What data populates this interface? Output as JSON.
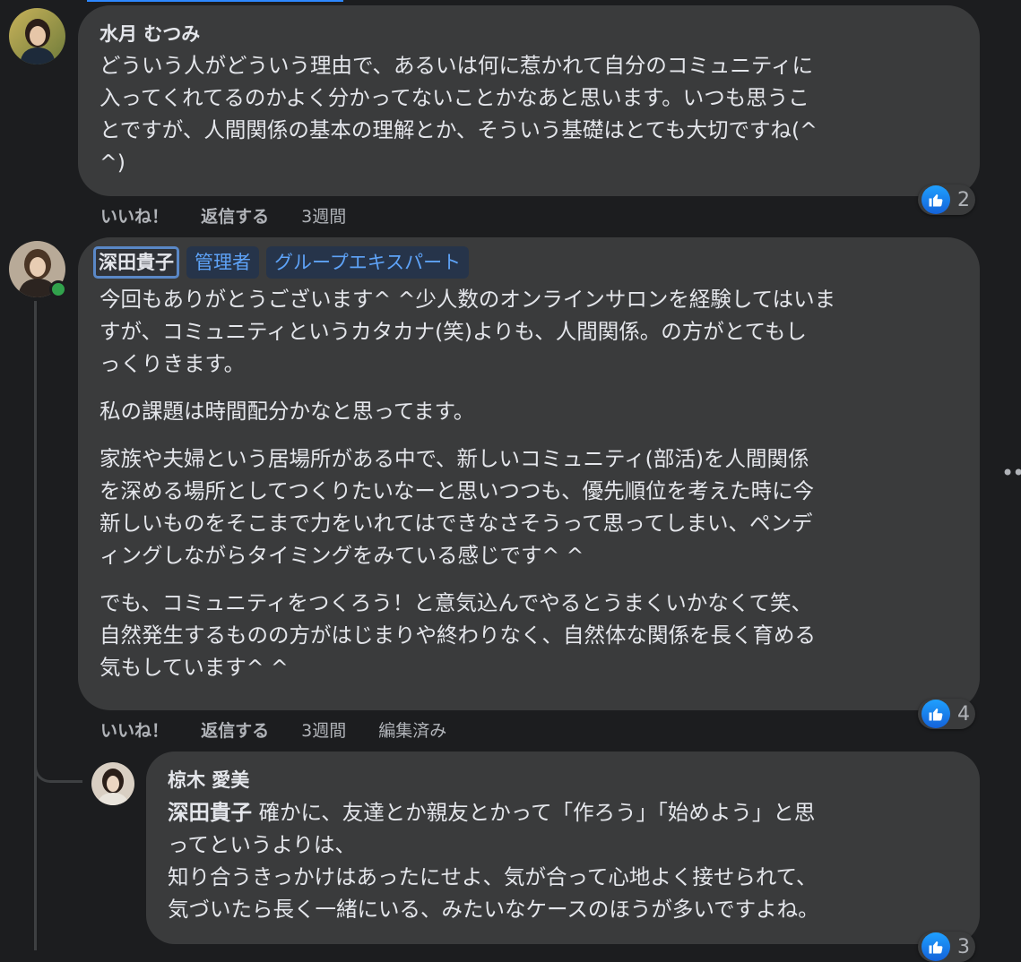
{
  "comments": [
    {
      "author": "水月 むつみ",
      "lines": [
        "どういう人がどういう理由で、あるいは何に惹かれて自分のコミュニティに",
        "入ってくれてるのかよく分かってないことかなあと思います。いつも思うこ",
        "とですが、人間関係の基本の理解とか、そういう基礎はとても大切ですね(^",
        "^)"
      ],
      "actions": {
        "like": "いいね！",
        "reply": "返信する",
        "time": "3週間"
      },
      "reactions": {
        "icon": "like-icon",
        "count": "2"
      }
    },
    {
      "author": "深田貴子",
      "badges": [
        "管理者",
        "グループエキスパート"
      ],
      "paragraphs": [
        [
          "今回もありがとうございます^ ^少人数のオンラインサロンを経験してはいま",
          "すが、コミュニティというカタカナ(笑)よりも、人間関係。の方がとてもし",
          "っくりきます。"
        ],
        [
          "私の課題は時間配分かなと思ってます。"
        ],
        [
          "家族や夫婦という居場所がある中で、新しいコミュニティ(部活)を人間関係",
          "を深める場所としてつくりたいなーと思いつつも、優先順位を考えた時に今",
          "新しいものをそこまで力をいれてはできなさそうって思ってしまい、ペンデ",
          "ィングしながらタイミングをみている感じです^ ^"
        ],
        [
          "でも、コミュニティをつくろう！と意気込んでやるとうまくいかなくて笑、",
          "自然発生するものの方がはじまりや終わりなく、自然体な関係を長く育める",
          "気もしています^ ^"
        ]
      ],
      "actions": {
        "like": "いいね！",
        "reply": "返信する",
        "time": "3週間",
        "edited": "編集済み"
      },
      "reactions": {
        "icon": "like-icon",
        "count": "4"
      }
    },
    {
      "author": "椋木 愛美",
      "mention": "深田貴子",
      "lines": [
        " 確かに、友達とか親友とかって「作ろう」「始めよう」と思",
        "ってというよりは、",
        "知り合うきっかけはあったにせよ、気が合って心地よく接せられて、",
        "気づいたら長く一緒にいる、みたいなケースのほうが多いですよね。"
      ],
      "reactions": {
        "icon": "like-icon",
        "count": "3"
      }
    }
  ],
  "colors": {
    "background": "#1c1d1f",
    "bubble": "#3a3b3c",
    "text": "#e4e6eb",
    "secondary_text": "#b0b3b8",
    "badge_text": "#5ea3f8",
    "like_blue": "#1877f2",
    "online": "#31a24c"
  }
}
